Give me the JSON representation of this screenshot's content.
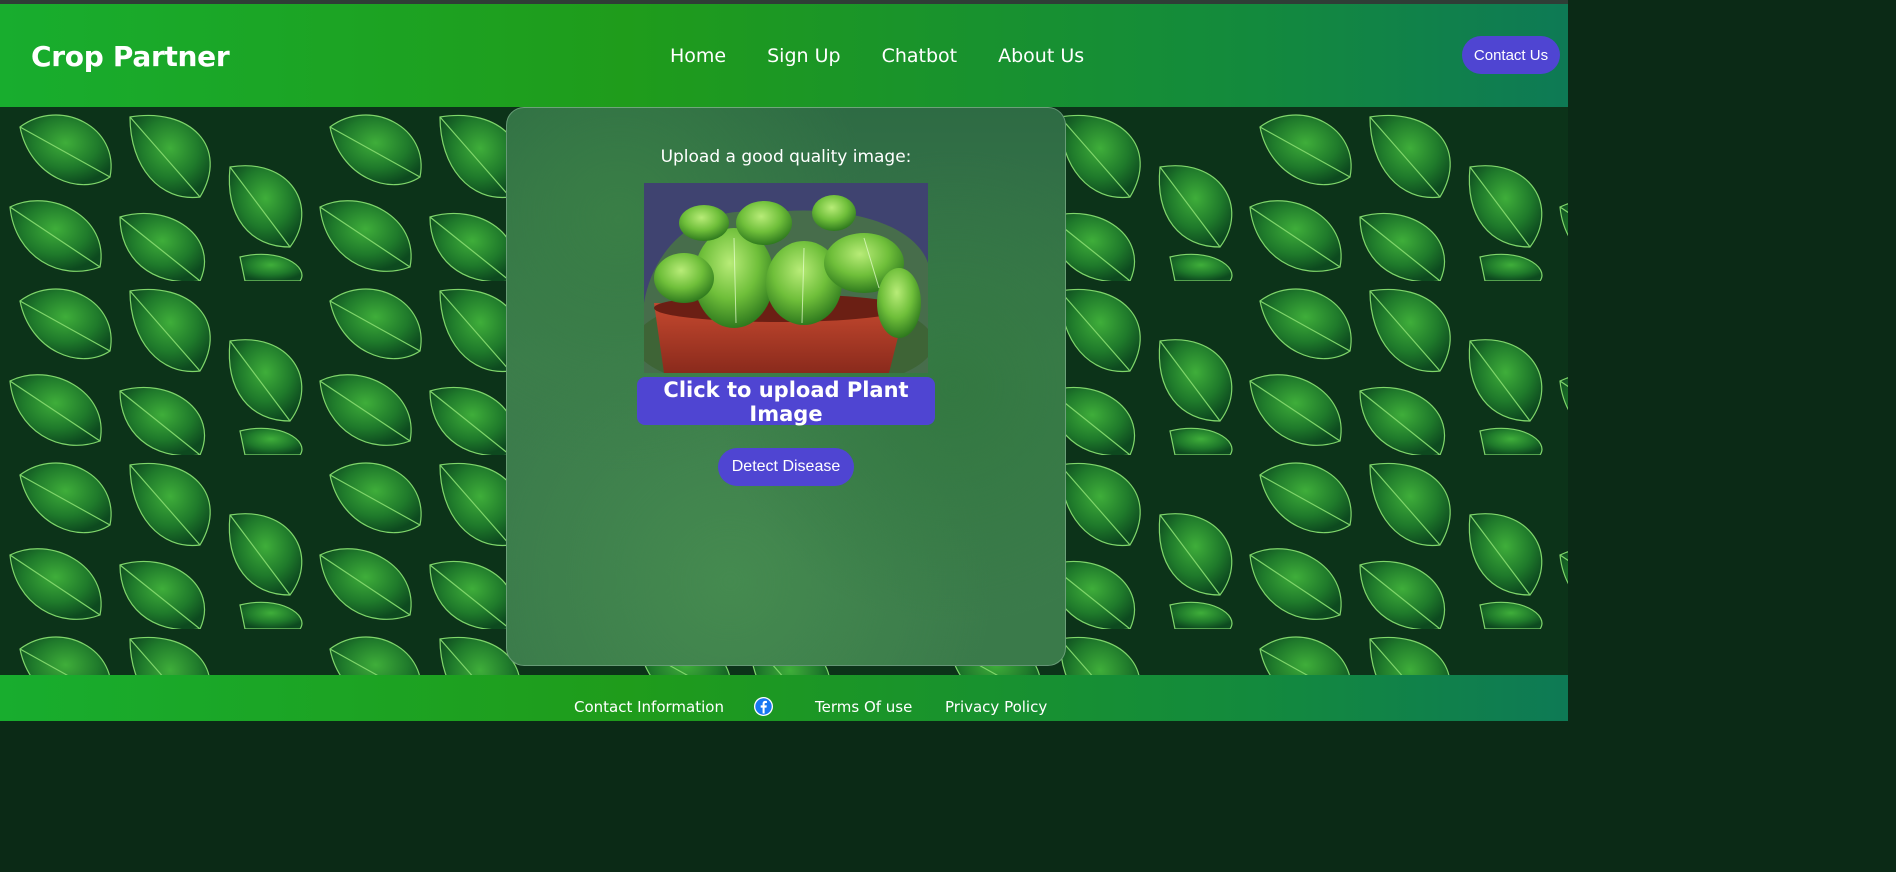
{
  "header": {
    "brand": "Crop Partner",
    "nav": [
      {
        "label": "Home"
      },
      {
        "label": "Sign Up"
      },
      {
        "label": "Chatbot"
      },
      {
        "label": "About Us"
      }
    ],
    "contact_button": "Contact Us"
  },
  "main": {
    "upload_prompt": "Upload a good quality image:",
    "upload_button": "Click to upload Plant Image",
    "detect_button": "Detect Disease",
    "preview_image": "basil plant in red pot"
  },
  "footer": {
    "contact_info": "Contact Information",
    "social_icon": "facebook-icon",
    "terms": "Terms Of use",
    "privacy": "Privacy Policy"
  },
  "colors": {
    "header_green": "#1f9c1b",
    "accent_purple": "#4f45d2",
    "background_leaf": "#0f3a1c"
  }
}
